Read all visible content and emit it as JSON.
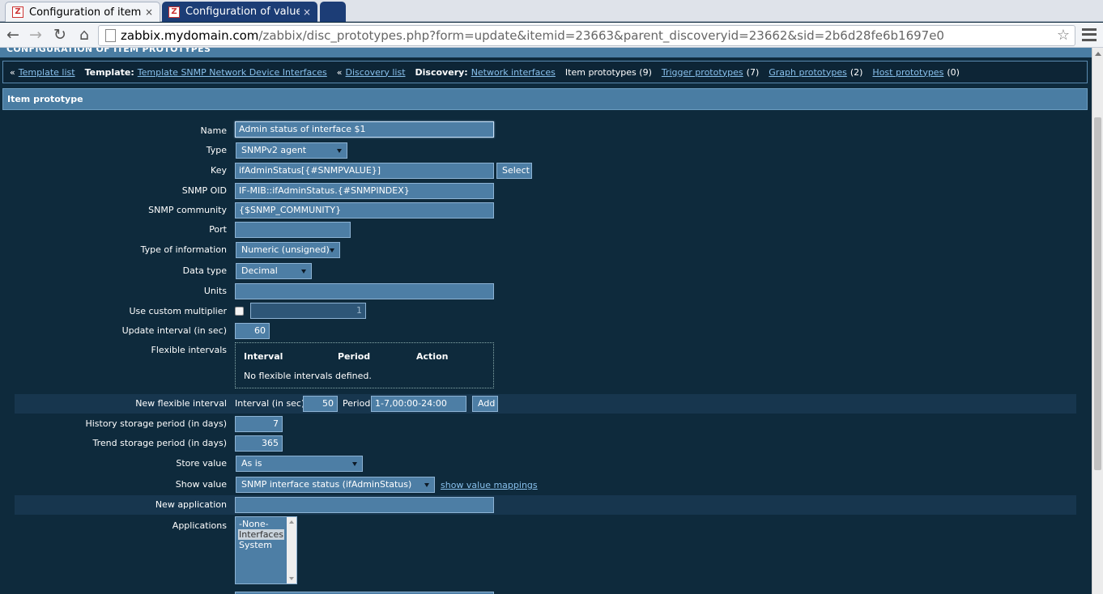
{
  "browser": {
    "tabs": [
      {
        "title": "Configuration of item pro",
        "active": true
      },
      {
        "title": "Configuration of value m",
        "active": false
      }
    ],
    "url_host": "zabbix.mydomain.com",
    "url_path": "/zabbix/disc_prototypes.php?form=update&itemid=23663&parent_discoveryid=23662&sid=2b6d28fe6b1697e0"
  },
  "header": {
    "title": "CONFIGURATION OF ITEM PROTOTYPES"
  },
  "breadcrumbs": {
    "template_list": "Template list",
    "template_label": "Template:",
    "template_name": "Template SNMP Network Device Interfaces",
    "discovery_list": "Discovery list",
    "discovery_label": "Discovery:",
    "discovery_name": "Network interfaces",
    "item_prototypes": "Item prototypes (9)",
    "trigger_prototypes": "Trigger prototypes",
    "trigger_count": "(7)",
    "graph_prototypes": "Graph prototypes",
    "graph_count": "(2)",
    "host_prototypes": "Host prototypes",
    "host_count": "(0)",
    "sep": "«"
  },
  "form": {
    "title": "Item prototype",
    "name": {
      "label": "Name",
      "value": "Admin status of interface $1"
    },
    "type": {
      "label": "Type",
      "value": "SNMPv2 agent"
    },
    "key": {
      "label": "Key",
      "value": "ifAdminStatus[{#SNMPVALUE}]",
      "button": "Select"
    },
    "snmp_oid": {
      "label": "SNMP OID",
      "value": "IF-MIB::ifAdminStatus.{#SNMPINDEX}"
    },
    "snmp_community": {
      "label": "SNMP community",
      "value": "{$SNMP_COMMUNITY}"
    },
    "port": {
      "label": "Port",
      "value": ""
    },
    "type_of_information": {
      "label": "Type of information",
      "value": "Numeric (unsigned)"
    },
    "data_type": {
      "label": "Data type",
      "value": "Decimal"
    },
    "units": {
      "label": "Units",
      "value": ""
    },
    "custom_multiplier": {
      "label": "Use custom multiplier",
      "value": "1",
      "checked": false
    },
    "update_interval": {
      "label": "Update interval (in sec)",
      "value": "60"
    },
    "flexible_intervals": {
      "label": "Flexible intervals",
      "col_interval": "Interval",
      "col_period": "Period",
      "col_action": "Action",
      "empty": "No flexible intervals defined."
    },
    "new_flexible": {
      "label": "New flexible interval",
      "interval_label": "Interval (in sec)",
      "interval_value": "50",
      "period_label": "Period",
      "period_value": "1-7,00:00-24:00",
      "add": "Add"
    },
    "history": {
      "label": "History storage period (in days)",
      "value": "7"
    },
    "trend": {
      "label": "Trend storage period (in days)",
      "value": "365"
    },
    "store_value": {
      "label": "Store value",
      "value": "As is"
    },
    "show_value": {
      "label": "Show value",
      "value": "SNMP interface status (ifAdminStatus)",
      "link": "show value mappings"
    },
    "new_application": {
      "label": "New application",
      "value": ""
    },
    "applications": {
      "label": "Applications",
      "options": [
        "-None-",
        "Interfaces",
        "System"
      ],
      "selected": "Interfaces"
    }
  },
  "colors": {
    "page_bg": "#0e2a3c",
    "header_bg": "#4a7da3",
    "input_bg": "#4d7ea5",
    "link": "#88c0ec"
  }
}
